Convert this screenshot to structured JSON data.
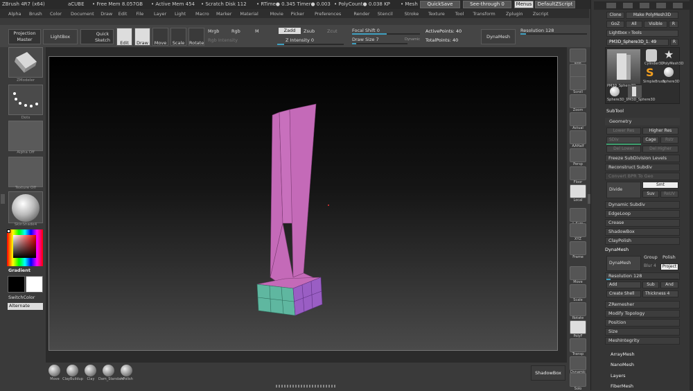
{
  "titlebar": {
    "app": "ZBrush 4R7 (x64)",
    "tool": "aCUBE",
    "free_mem": "• Free Mem 8.057GB",
    "active_mem": "• Active Mem 454",
    "scratch": "• Scratch Disk 112",
    "rtime": "• RTime● 0.345 Timer● 0.003",
    "polycount": "• PolyCount● 0.038 KP",
    "mesh": "• Mesh",
    "quicksave": "QuickSave",
    "seethrough": "See-through 0",
    "menus": "Menus",
    "script": "DefaultZScript"
  },
  "menu": [
    "Alpha",
    "Brush",
    "Color",
    "Document",
    "Draw",
    "Edit",
    "File",
    "Layer",
    "Light",
    "Macro",
    "Marker",
    "Material",
    "Movie",
    "Picker",
    "Preferences",
    "Render",
    "Stencil",
    "Stroke",
    "Texture",
    "Tool",
    "Transform",
    "Zplugin",
    "Zscript"
  ],
  "toolbar": {
    "projection_master": "Projection Master",
    "lightbox": "LightBox",
    "quick_sketch": "Quick Sketch",
    "edit": "Edit",
    "draw": "Draw",
    "move": "Move",
    "scale": "Scale",
    "rotate": "Rotate",
    "mrgb": "Mrgb",
    "rgb": "Rgb",
    "m": "M",
    "zadd": "Zadd",
    "zsub": "Zsub",
    "zcut": "Zcut",
    "rgb_intensity": "Rgb Intensity",
    "z_intensity": "Z Intensity 0",
    "focal_shift": "Focal Shift 0",
    "draw_size": "Draw Size 7",
    "dynamic": "Dynamic",
    "active_points": "ActivePoints: 40",
    "total_points": "TotalPoints: 40",
    "dynamesh": "DynaMesh",
    "resolution": "Resolution 128"
  },
  "leftshelf": {
    "brush": "ZModeler",
    "stroke": "Dots",
    "alpha": "Alpha Off",
    "texture": "Texture Off",
    "material": "SkinShade4",
    "gradient": "Gradient",
    "switchcolor": "SwitchColor",
    "alternate": "Alternate"
  },
  "rightshelf": [
    "BPR",
    "SPix",
    "Scroll",
    "Zoom",
    "Actual",
    "AAHalf",
    "Persp",
    "Floor",
    "Local",
    "L.Sym",
    "XYZ",
    "Frame",
    "Move",
    "Scale",
    "Rotate",
    "PolyF",
    "Transp",
    "Dynamic",
    "Solo"
  ],
  "bottom": {
    "brushes": [
      "Move",
      "ClayBuildup",
      "Clay",
      "Dam_Standard",
      "hPolish"
    ],
    "shadowbox": "ShadowBox"
  },
  "tray": {
    "top_buttons": [
      "Clone",
      "Make PolyMesh3D",
      "GoZ",
      "All",
      "Visible",
      "R"
    ],
    "lightbox_tools": "Lightbox › Tools",
    "current_tool": "PM3D_Sphere3D_1. 49",
    "tool_thumbs": [
      "PM3D_Sphere3D",
      "Cylinder3D",
      "PolyMesh3D",
      "SimpleBrush",
      "Sphere3D",
      "Sphere3D_1",
      "PM3D_Sphere3D"
    ],
    "subtool": "SubTool",
    "geometry": "Geometry",
    "lower_res": "Lower Res",
    "higher_res": "Higher Res",
    "sdiv": "SDiv",
    "cage": "Cage",
    "rstr": "Rstr",
    "del_lower": "Del Lower",
    "del_higher": "Del Higher",
    "freeze": "Freeze SubDivision Levels",
    "reconstruct": "Reconstruct Subdiv",
    "convert_bpr": "Convert BPR To Geo",
    "divide": "Divide",
    "smt": "Smt",
    "suv": "Suv",
    "reuv": "ReUV",
    "dynamic_subdiv": "Dynamic Subdiv",
    "edgeloop": "EdgeLoop",
    "crease": "Crease",
    "shadowbox": "ShadowBox",
    "claypolish": "ClayPolish",
    "dynamesh_sub": "DynaMesh",
    "dynamesh_btn": "DynaMesh",
    "group": "Group",
    "polish": "Polish",
    "blur": "Blur 4",
    "project": "Project",
    "resolution": "Resolution 128",
    "add": "Add",
    "sub": "Sub",
    "and": "And",
    "create_shell": "Create Shell",
    "thickness": "Thickness 4",
    "zremesher": "ZRemesher",
    "modify_topology": "Modify Topology",
    "position": "Position",
    "size": "Size",
    "meshintegrity": "MeshIntegrity",
    "arraymesh": "ArrayMesh",
    "nanomesh": "NanoMesh",
    "layers": "Layers",
    "fibermesh": "FiberMesh"
  },
  "colors": {
    "accent": "#3fa0c0",
    "model_pink": "#c46ab8",
    "model_teal": "#5fb7a0",
    "model_purple": "#9a5ec4"
  }
}
